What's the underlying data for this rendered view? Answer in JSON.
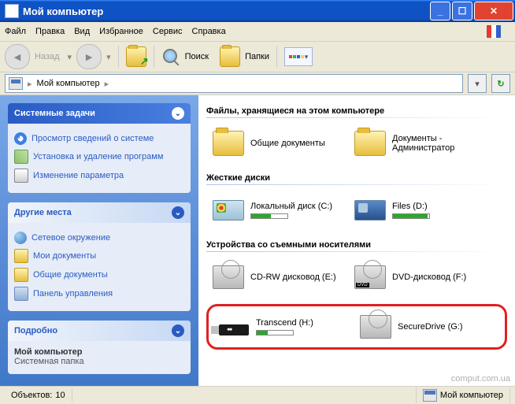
{
  "window": {
    "title": "Мой компьютер"
  },
  "menu": {
    "file": "Файл",
    "edit": "Правка",
    "view": "Вид",
    "favorites": "Избранное",
    "tools": "Сервис",
    "help": "Справка"
  },
  "toolbar": {
    "back": "Назад",
    "search": "Поиск",
    "folders": "Папки"
  },
  "address": {
    "root": "Мой компьютер"
  },
  "sidebar": {
    "tasks": {
      "title": "Системные задачи",
      "items": [
        {
          "label": "Просмотр сведений о системе"
        },
        {
          "label": "Установка и удаление программ"
        },
        {
          "label": "Изменение параметра"
        }
      ]
    },
    "places": {
      "title": "Другие места",
      "items": [
        {
          "label": "Сетевое окружение"
        },
        {
          "label": "Мои документы"
        },
        {
          "label": "Общие документы"
        },
        {
          "label": "Панель управления"
        }
      ]
    },
    "details": {
      "title": "Подробно",
      "name": "Мой компьютер",
      "type": "Системная папка"
    }
  },
  "content": {
    "section_files": "Файлы, хранящиеся на этом компьютере",
    "files": [
      {
        "label": "Общие документы"
      },
      {
        "label": "Документы - Администратор"
      }
    ],
    "section_drives": "Жесткие диски",
    "drives": [
      {
        "label": "Локальный диск (C:)",
        "fill": 55
      },
      {
        "label": "Files (D:)",
        "fill": 95
      }
    ],
    "section_removable": "Устройства со съемными носителями",
    "removable": [
      {
        "label": "CD-RW дисковод (E:)"
      },
      {
        "label": "DVD-дисковод (F:)"
      }
    ],
    "highlighted": [
      {
        "label": "Transcend (H:)",
        "fill": 30
      },
      {
        "label": "SecureDrive (G:)"
      }
    ]
  },
  "status": {
    "objects_label": "Объектов:",
    "objects_count": "10",
    "location": "Мой компьютер"
  },
  "watermark": "comput.com.ua"
}
